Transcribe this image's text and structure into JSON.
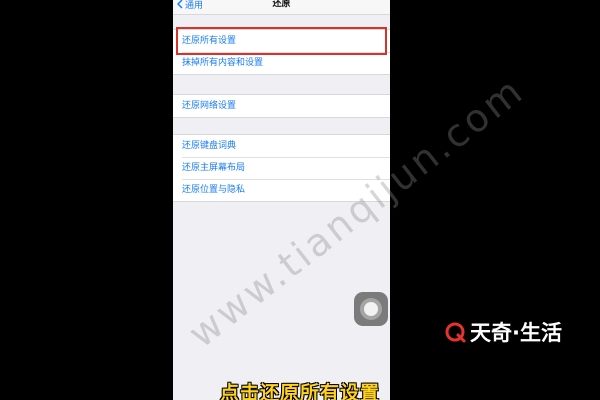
{
  "navbar": {
    "back_label": "通用",
    "title": "还原"
  },
  "groups": [
    {
      "items": [
        "还原所有设置",
        "抹掉所有内容和设置"
      ]
    },
    {
      "items": [
        "还原网络设置"
      ]
    },
    {
      "items": [
        "还原键盘词典",
        "还原主屏幕布局",
        "还原位置与隐私"
      ]
    }
  ],
  "watermark": "www.tianqijun.com",
  "brand": {
    "name": "天奇·生活"
  },
  "subtitle": "点击还原所有设置",
  "colors": {
    "accent": "#1a7cf5",
    "highlight": "#d9322b",
    "subtitle": "#ffd21f"
  }
}
